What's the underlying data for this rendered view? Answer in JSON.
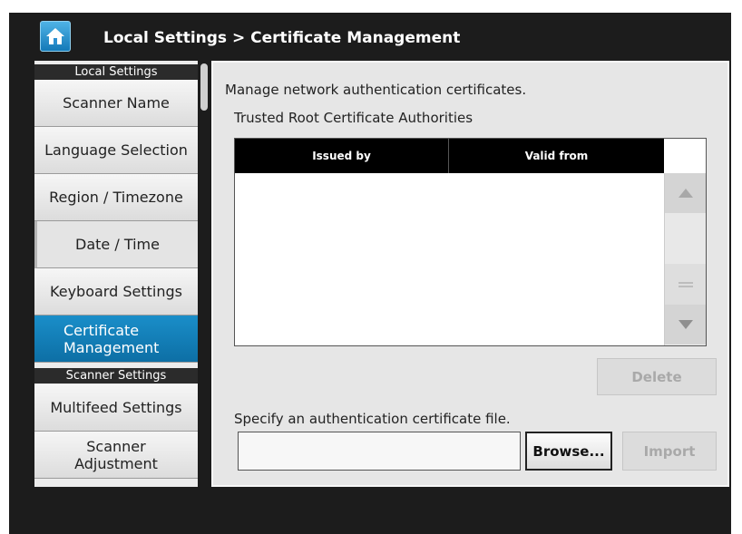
{
  "header": {
    "title": "Local Settings > Certificate Management",
    "home_icon": "home-icon"
  },
  "sidebar": {
    "groups": [
      {
        "label": "Local Settings"
      },
      {
        "label": "Scanner Settings"
      }
    ],
    "items": [
      {
        "label": "Scanner Name"
      },
      {
        "label": "Language Selection"
      },
      {
        "label": "Region / Timezone"
      },
      {
        "label": "Date / Time"
      },
      {
        "label": "Keyboard Settings"
      },
      {
        "label": "Certificate\nManagement",
        "selected": true
      },
      {
        "label": "Multifeed Settings"
      },
      {
        "label": "Scanner\nAdjustment"
      }
    ]
  },
  "main": {
    "description": "Manage network authentication certificates.",
    "section_title": "Trusted Root Certificate Authorities",
    "table": {
      "columns": [
        "Issued by",
        "Valid from"
      ],
      "rows": []
    },
    "delete_label": "Delete",
    "file_prompt": "Specify an authentication certificate file.",
    "file_value": "",
    "browse_label": "Browse...",
    "import_label": "Import"
  },
  "colors": {
    "selected_item": "#0d7fba",
    "title_bar": "#1c1c1c",
    "header_row": "#000000"
  }
}
